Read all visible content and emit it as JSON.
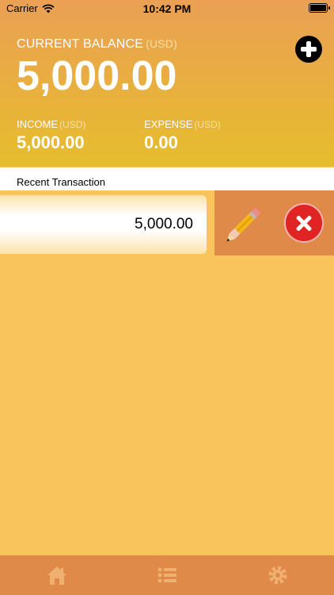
{
  "status_bar": {
    "carrier": "Carrier",
    "time": "10:42 PM",
    "battery_percent": 100
  },
  "balance": {
    "label": "CURRENT BALANCE",
    "currency": "(USD)",
    "value": "5,000.00"
  },
  "income": {
    "label": "INCOME",
    "currency": "(USD)",
    "value": "5,000.00"
  },
  "expense": {
    "label": "EXPENSE",
    "currency": "(USD)",
    "value": "0.00"
  },
  "recent": {
    "title": "Recent Transaction",
    "transactions": [
      {
        "amount": "5,000.00"
      }
    ]
  },
  "icons": {
    "add": "plus-circle-icon",
    "edit": "pencil-icon",
    "delete": "close-circle-icon",
    "tabs": [
      "home-icon",
      "list-icon",
      "gear-icon"
    ]
  },
  "colors": {
    "background": "#fac45c",
    "header_top": "#eba054",
    "header_bottom": "#e6bd2e",
    "action_bar": "#e08a4a",
    "delete": "#e02424"
  }
}
